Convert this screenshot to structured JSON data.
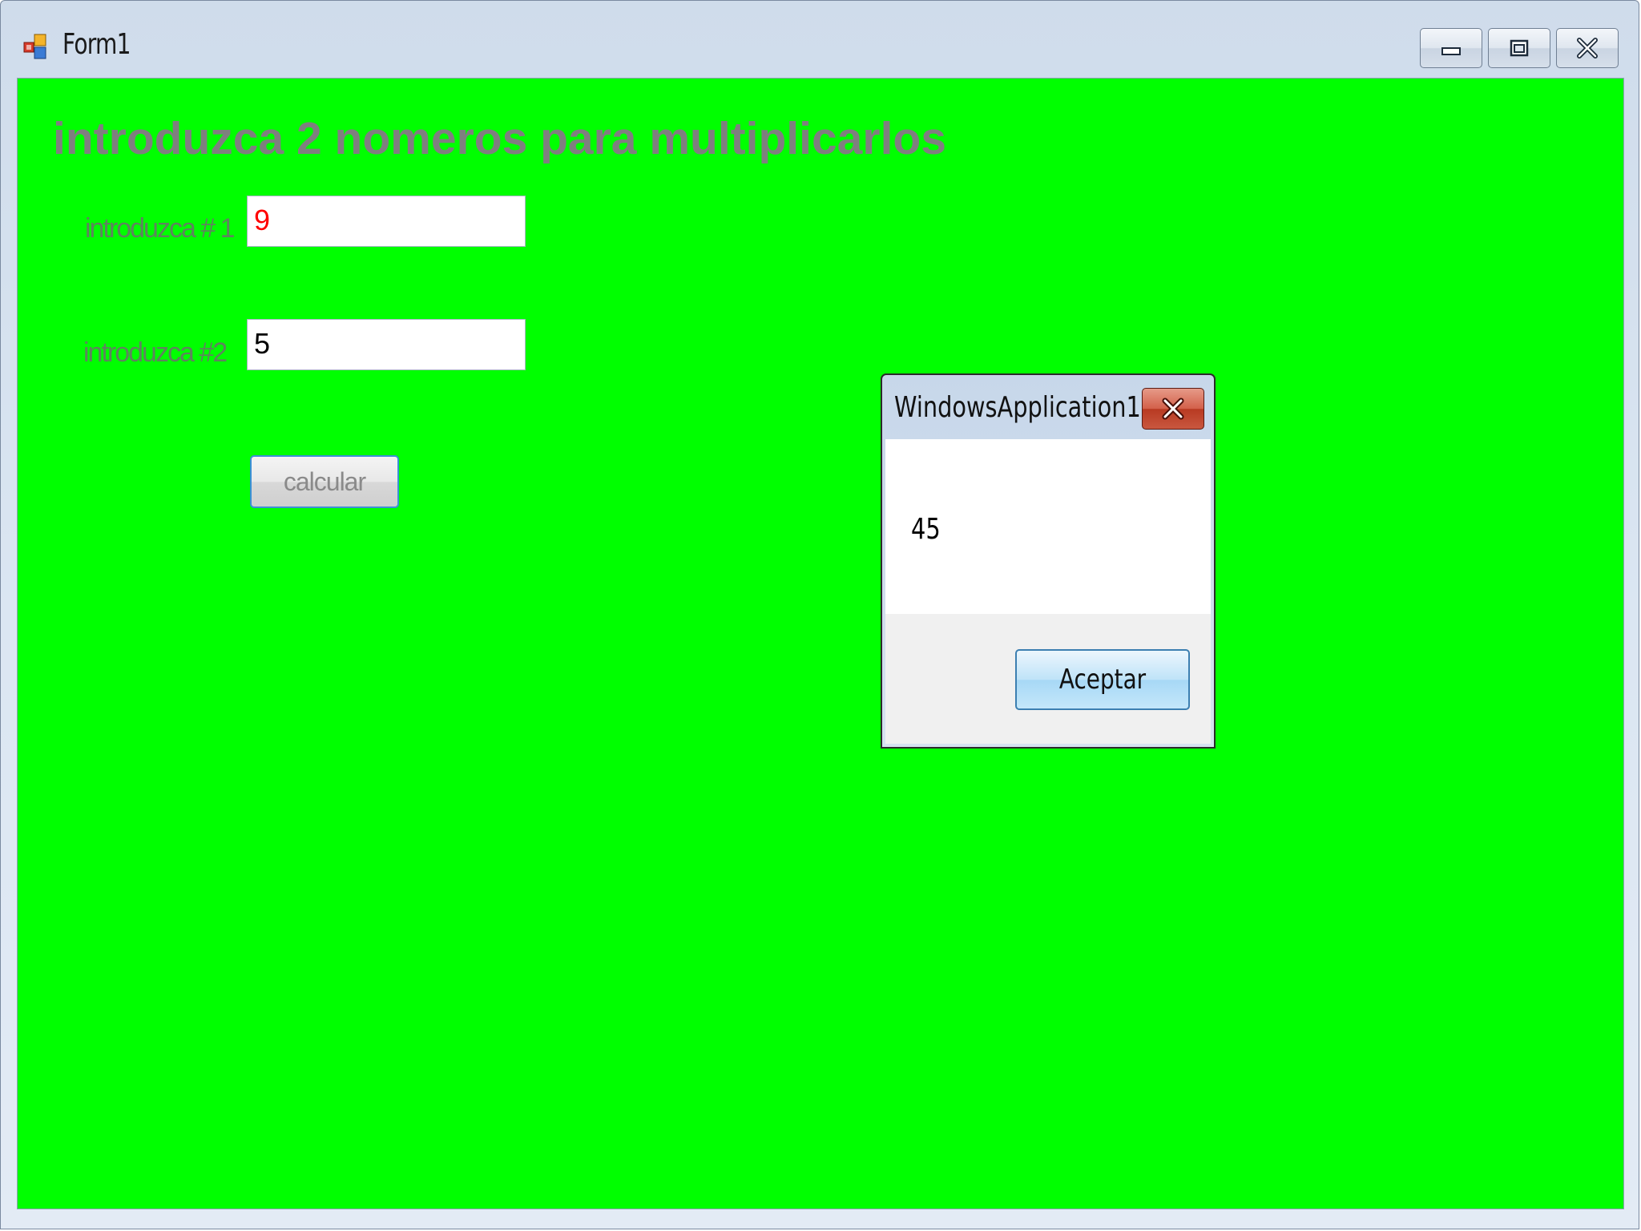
{
  "window": {
    "title": "Form1",
    "icon": "form-app-icon",
    "controls": {
      "minimize_icon": "minimize-icon",
      "maximize_icon": "maximize-icon",
      "close_icon": "close-icon"
    }
  },
  "form": {
    "background_color": "#00ff00",
    "heading": "introduzca 2 nomeros para multiplicarlos",
    "label_1": "introduzca # 1",
    "value_1": "9",
    "value_1_color": "#ff0000",
    "label_2": "introduzca #2",
    "value_2": "5",
    "calculate_button": "calcular"
  },
  "message_box": {
    "title": "WindowsApplication1",
    "message": "45",
    "ok_button": "Aceptar",
    "close_icon": "close-icon"
  }
}
